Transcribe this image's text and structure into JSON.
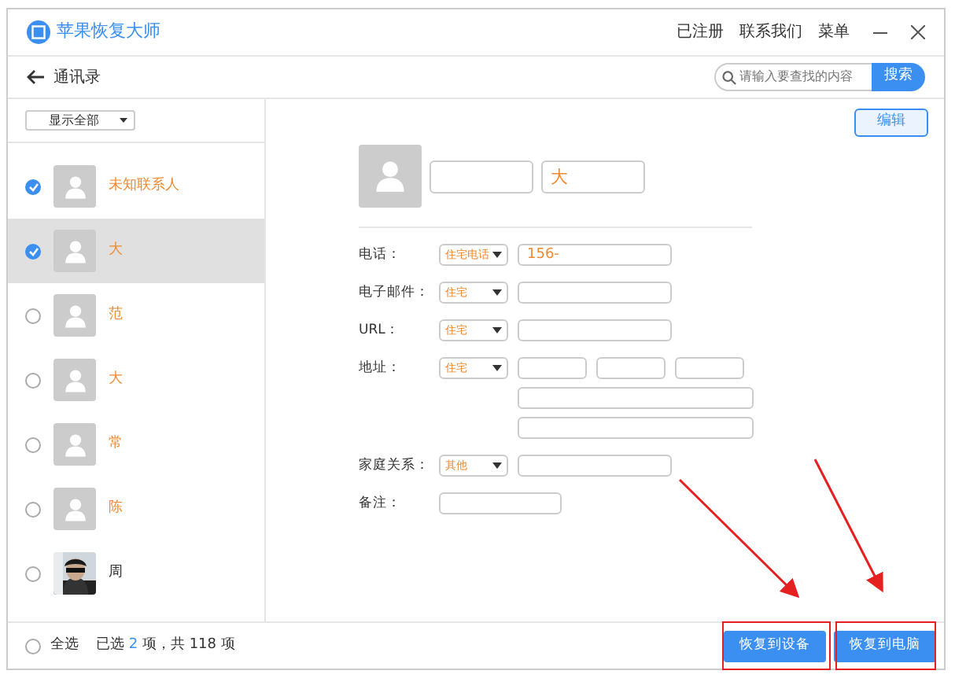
{
  "app": {
    "title": "苹果恢复大师",
    "menu": [
      "已注册",
      "联系我们",
      "菜单"
    ]
  },
  "toolbar": {
    "back_label": "通讯录",
    "search": {
      "placeholder": "请输入要查找的内容"
    },
    "search_button": "搜索"
  },
  "filter": {
    "value": "显示全部"
  },
  "contacts": [
    {
      "name": "未知联系人",
      "checked": true,
      "selected": false,
      "kind": "placeholder"
    },
    {
      "name": "大",
      "checked": true,
      "selected": true,
      "kind": "placeholder"
    },
    {
      "name": "范",
      "checked": false,
      "selected": false,
      "kind": "placeholder"
    },
    {
      "name": "大",
      "checked": false,
      "selected": false,
      "kind": "placeholder"
    },
    {
      "name": "常",
      "checked": false,
      "selected": false,
      "kind": "placeholder"
    },
    {
      "name": "陈",
      "checked": false,
      "selected": false,
      "kind": "placeholder"
    },
    {
      "name": "周",
      "checked": false,
      "selected": false
    }
  ],
  "footer": {
    "select_all": {
      "label": "全选",
      "checked": false
    },
    "selected_prefix": "已选",
    "selected_count": "2",
    "selected_suffix": "项，共 118 项",
    "buttons": [
      "恢复到设备",
      "恢复到电脑"
    ]
  },
  "detail": {
    "edit_button": "编辑",
    "last_name": "大",
    "fields": [
      {
        "label": "电话：",
        "type": "住宅电话",
        "inputs": [
          {
            "kind": "medium",
            "value": "156-"
          }
        ]
      },
      {
        "label": "电子邮件：",
        "type": "住宅",
        "inputs": [
          {
            "kind": "medium"
          }
        ]
      },
      {
        "label": "URL：",
        "type": "住宅",
        "inputs": [
          {
            "kind": "medium"
          }
        ]
      },
      {
        "label": "地址：",
        "type": "住宅",
        "inputs": [
          {
            "kind": "short"
          },
          {
            "kind": "short"
          },
          {
            "kind": "short"
          },
          {
            "kind": "wide"
          },
          {
            "kind": "wide"
          }
        ]
      },
      {
        "label": "家庭关系：",
        "type": "其他",
        "inputs": [
          {
            "kind": "medium"
          }
        ]
      },
      {
        "label": "备注：",
        "inputs": [
          {
            "kind": "medium"
          }
        ]
      }
    ]
  }
}
